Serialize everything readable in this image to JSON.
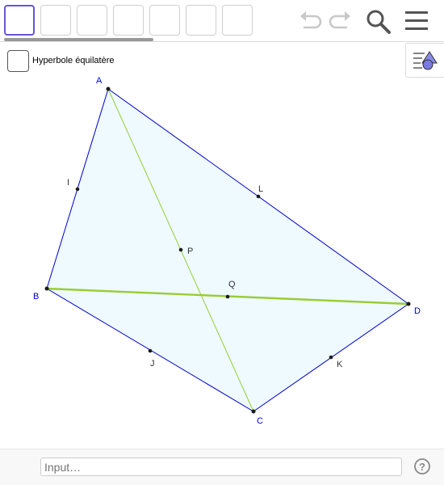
{
  "checkbox": {
    "label": "Hyperbole équilatère",
    "checked": false
  },
  "input_bar": {
    "placeholder": "Input…"
  },
  "icons": {
    "undo": "undo-icon",
    "redo": "redo-icon",
    "search": "search-icon",
    "menu": "menu-icon",
    "algebra": "algebra-view-toggle-icon",
    "help": "help-icon"
  },
  "colors": {
    "quad_fill": "#eefaff",
    "quad_stroke": "#0000cc",
    "diagonal_stroke": "#99cc33",
    "tool_active_border": "#6557d2",
    "point_label": "#0000cc",
    "midpoint_label": "#333333"
  },
  "points": {
    "A": "A",
    "B": "B",
    "C": "C",
    "D": "D",
    "I": "I",
    "J": "J",
    "K": "K",
    "L": "L",
    "P": "P",
    "Q": "Q"
  }
}
